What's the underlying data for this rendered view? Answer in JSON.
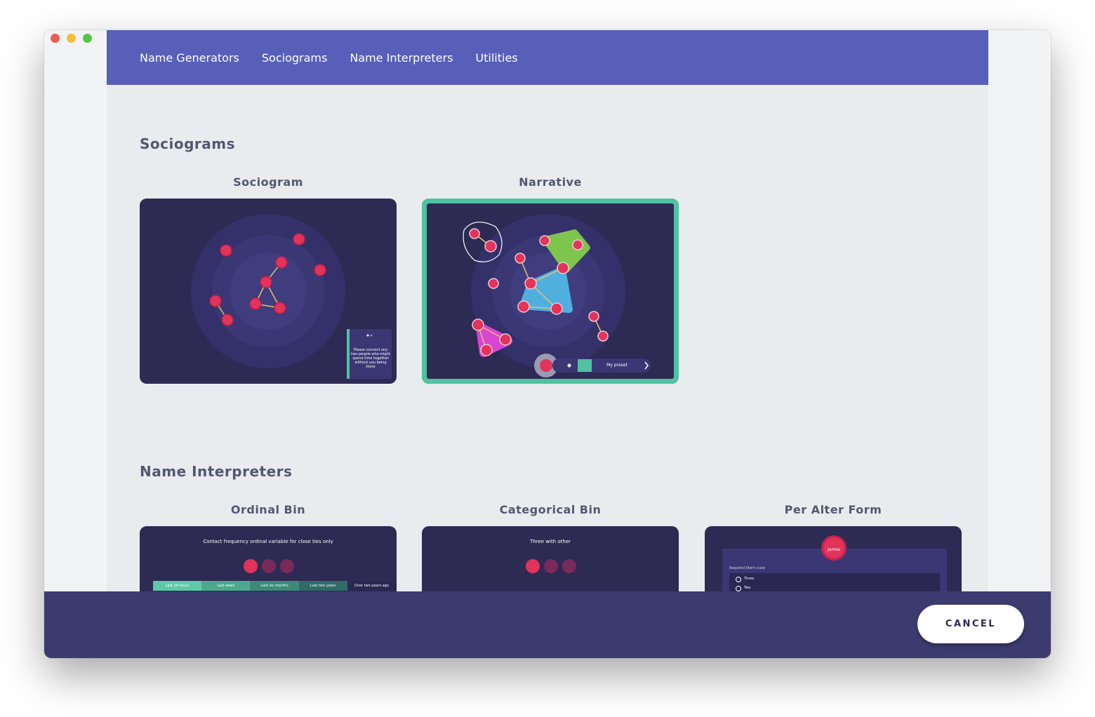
{
  "nav": {
    "items": [
      {
        "label": "Name Generators"
      },
      {
        "label": "Sociograms"
      },
      {
        "label": "Name Interpreters"
      },
      {
        "label": "Utilities"
      }
    ]
  },
  "sections": {
    "sociograms": {
      "title": "Sociograms",
      "cards": [
        {
          "label": "Sociogram",
          "selected": false
        },
        {
          "label": "Narrative",
          "selected": true
        }
      ]
    },
    "name_interpreters": {
      "title": "Name Interpreters",
      "cards": [
        {
          "label": "Ordinal Bin"
        },
        {
          "label": "Categorical Bin"
        },
        {
          "label": "Per Alter Form"
        }
      ]
    }
  },
  "previews": {
    "sociogram_prompt": "Please connect any two people who might spend time together without you being there",
    "narrative_preset": "My preset",
    "ordinal_prompt": "Contact frequency ordinal variable for close ties only",
    "ordinal_bins": [
      "Last 24 hours",
      "Last week",
      "Last six months",
      "Last two years",
      "Over two years ago"
    ],
    "categorical_prompt": "Three with other",
    "alter_name": "James",
    "alter_form_label": "Required likert scale",
    "alter_form_options": [
      "Three",
      "Two"
    ]
  },
  "footer": {
    "cancel_label": "CANCEL"
  },
  "colors": {
    "nav": "#575fb8",
    "card": "#2d2a53",
    "selected_border": "#4fc3a1",
    "node": "#e2335a",
    "footer": "#3c3b70"
  }
}
